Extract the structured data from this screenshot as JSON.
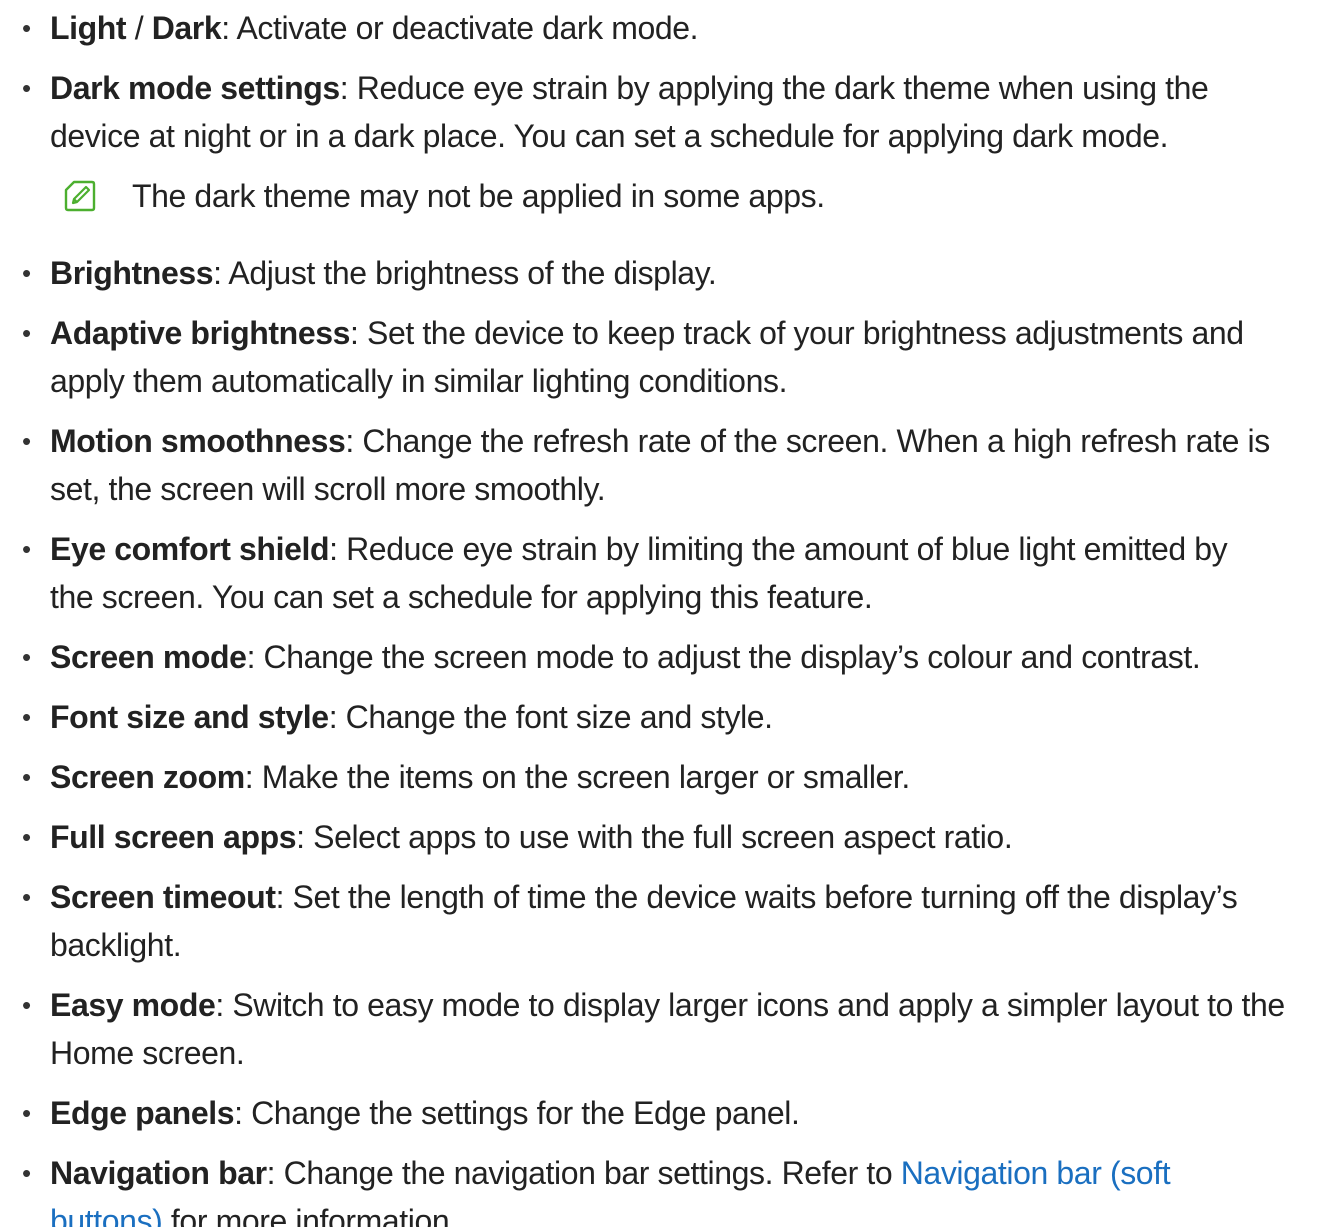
{
  "items": [
    {
      "term_a": "Light",
      "sep": " / ",
      "term_b": "Dark",
      "line1_rest": ": Activate or deactivate dark mode."
    },
    {
      "term": "Dark mode settings",
      "line1_rest": ": Reduce eye strain by applying the dark theme when using the",
      "line2": "device at night or in a dark place. You can set a schedule for applying dark mode.",
      "note": "The dark theme may not be applied in some apps.",
      "note_icon": "note-pencil-icon"
    },
    {
      "term": "Brightness",
      "line1_rest": ": Adjust the brightness of the display."
    },
    {
      "term": "Adaptive brightness",
      "line1_rest": ": Set the device to keep track of your brightness adjustments and",
      "line2": "apply them automatically in similar lighting conditions."
    },
    {
      "term": "Motion smoothness",
      "line1_rest": ": Change the refresh rate of the screen. When a high refresh rate is",
      "line2": "set, the screen will scroll more smoothly."
    },
    {
      "term": "Eye comfort shield",
      "line1_rest": ": Reduce eye strain by limiting the amount of blue light emitted by",
      "line2": "the screen. You can set a schedule for applying this feature."
    },
    {
      "term": "Screen mode",
      "line1_rest": ": Change the screen mode to adjust the display’s colour and contrast."
    },
    {
      "term": "Font size and style",
      "line1_rest": ": Change the font size and style."
    },
    {
      "term": "Screen zoom",
      "line1_rest": ": Make the items on the screen larger or smaller."
    },
    {
      "term": "Full screen apps",
      "line1_rest": ": Select apps to use with the full screen aspect ratio."
    },
    {
      "term": "Screen timeout",
      "line1_rest": ": Set the length of time the device waits before turning off the display’s",
      "line2": "backlight."
    },
    {
      "term": "Easy mode",
      "line1_rest": ": Switch to easy mode to display larger icons and apply a simpler layout to the",
      "line2": "Home screen."
    },
    {
      "term": "Edge panels",
      "line1_rest": ": Change the settings for the Edge panel."
    },
    {
      "term": "Navigation bar",
      "line1_rest": ": Change the navigation bar settings. Refer to ",
      "link_part1": "Navigation bar (soft",
      "link_part2": "buttons)",
      "line2_rest": " for more information."
    }
  ],
  "bullet_char": "•",
  "colors": {
    "text": "#222222",
    "link": "#1a6fc0",
    "note_icon": "#4caf2f"
  }
}
